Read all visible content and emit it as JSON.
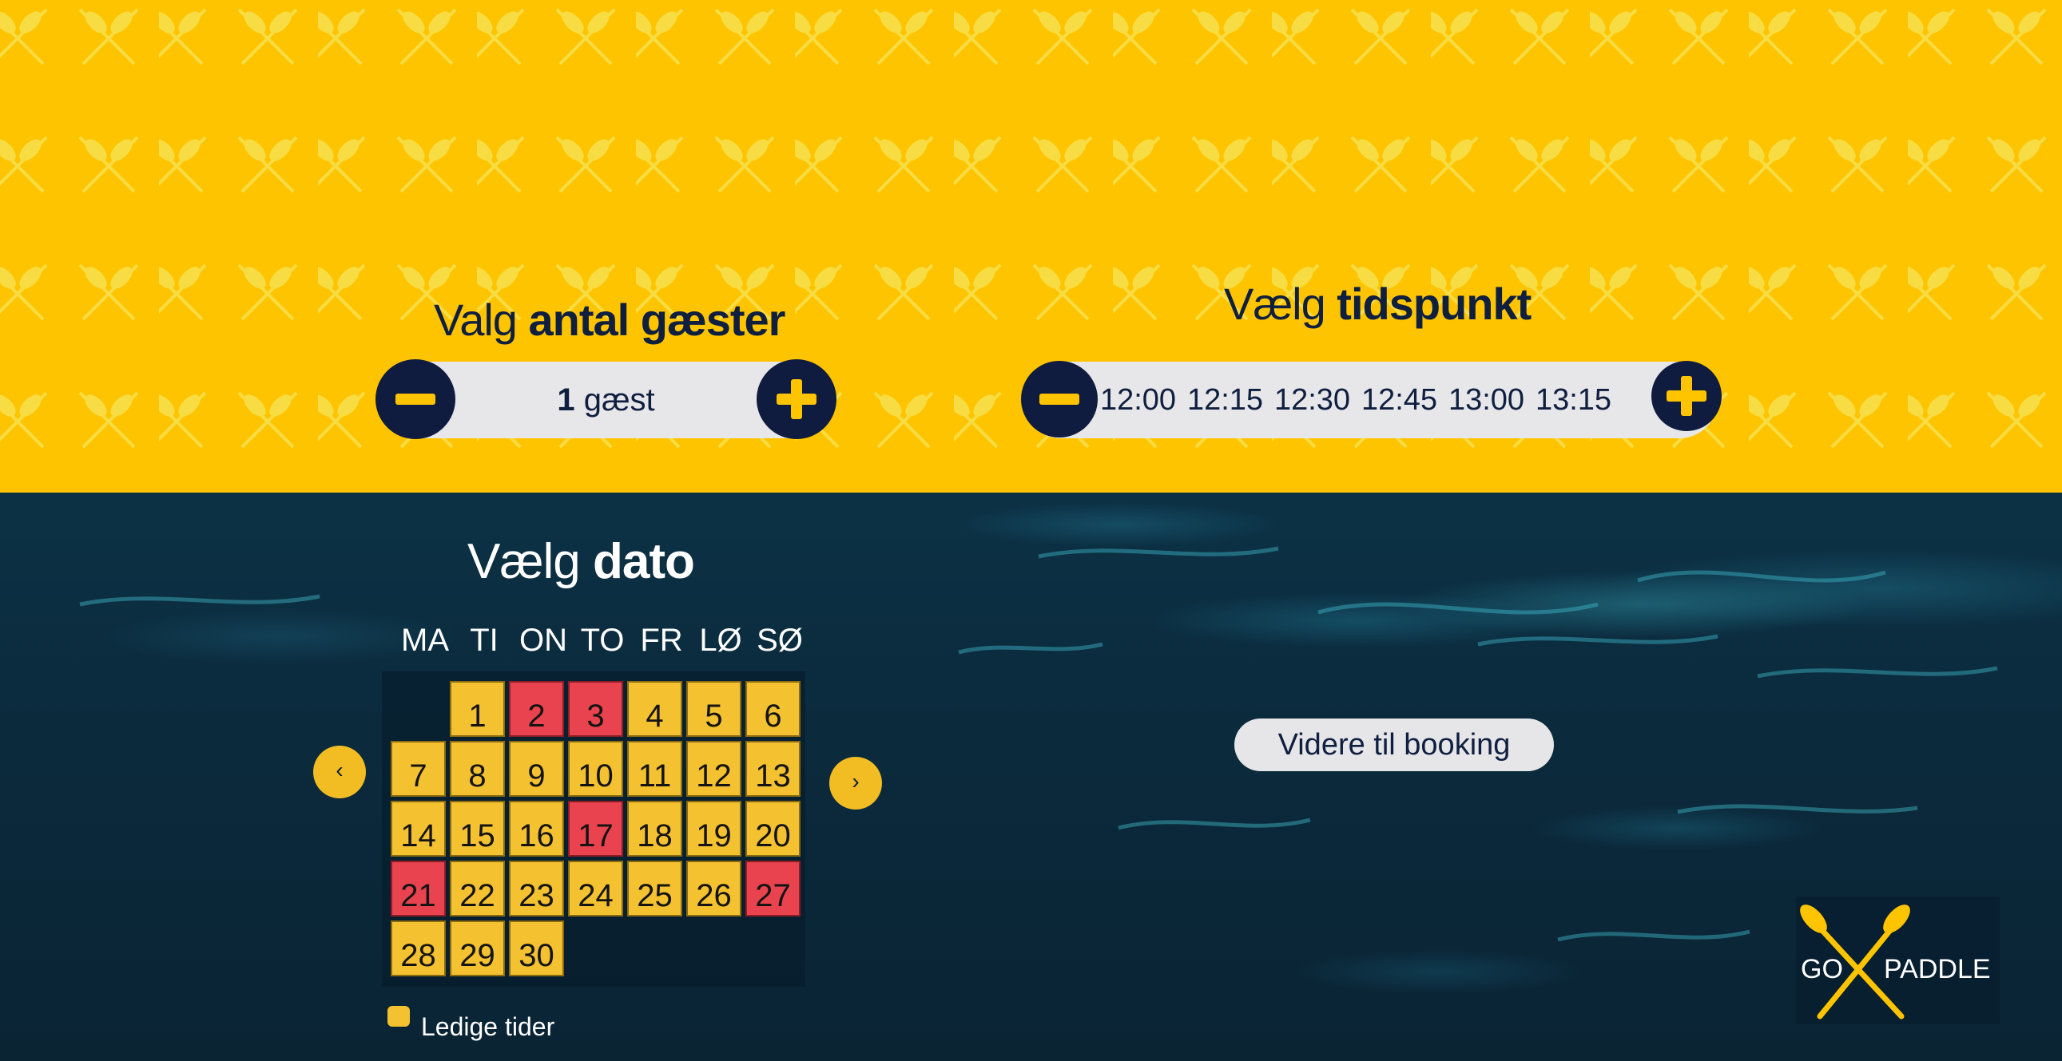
{
  "colors": {
    "accent": "#fec400",
    "navy": "#0f1c3f",
    "booked": "#e8434e",
    "available": "#f4c130"
  },
  "guests": {
    "heading_prefix": "Valg ",
    "heading_bold": "antal gæster",
    "count": "1",
    "unit": " gæst",
    "minus_icon": "minus-icon",
    "plus_icon": "plus-icon"
  },
  "time": {
    "heading_prefix": "Vælg ",
    "heading_bold": "tidspunkt",
    "slots": [
      "12:00",
      "12:15",
      "12:30",
      "12:45",
      "13:00",
      "13:15"
    ]
  },
  "date": {
    "heading_prefix": "Vælg ",
    "heading_bold": "dato",
    "weekdays": [
      "MA",
      "TI",
      "ON",
      "TO",
      "FR",
      "LØ",
      "SØ"
    ],
    "prev_icon": "‹",
    "next_icon": "›",
    "days": [
      {
        "day": "1",
        "status": "available"
      },
      {
        "day": "2",
        "status": "booked"
      },
      {
        "day": "3",
        "status": "booked"
      },
      {
        "day": "4",
        "status": "available"
      },
      {
        "day": "5",
        "status": "available"
      },
      {
        "day": "6",
        "status": "available"
      },
      {
        "day": "7",
        "status": "available"
      },
      {
        "day": "8",
        "status": "available"
      },
      {
        "day": "9",
        "status": "available"
      },
      {
        "day": "10",
        "status": "available"
      },
      {
        "day": "11",
        "status": "available"
      },
      {
        "day": "12",
        "status": "available"
      },
      {
        "day": "13",
        "status": "available"
      },
      {
        "day": "14",
        "status": "available"
      },
      {
        "day": "15",
        "status": "available"
      },
      {
        "day": "16",
        "status": "available"
      },
      {
        "day": "17",
        "status": "booked"
      },
      {
        "day": "18",
        "status": "available"
      },
      {
        "day": "19",
        "status": "available"
      },
      {
        "day": "20",
        "status": "available"
      },
      {
        "day": "21",
        "status": "booked"
      },
      {
        "day": "22",
        "status": "available"
      },
      {
        "day": "23",
        "status": "available"
      },
      {
        "day": "24",
        "status": "available"
      },
      {
        "day": "25",
        "status": "available"
      },
      {
        "day": "26",
        "status": "available"
      },
      {
        "day": "27",
        "status": "booked"
      },
      {
        "day": "28",
        "status": "available"
      },
      {
        "day": "29",
        "status": "available"
      },
      {
        "day": "30",
        "status": "available"
      }
    ],
    "legend_label": "Ledige tider"
  },
  "booking_button": "Videre til booking",
  "logo": {
    "left": "GO",
    "right": "PADDLE",
    "icon": "crossed-paddles-icon"
  }
}
